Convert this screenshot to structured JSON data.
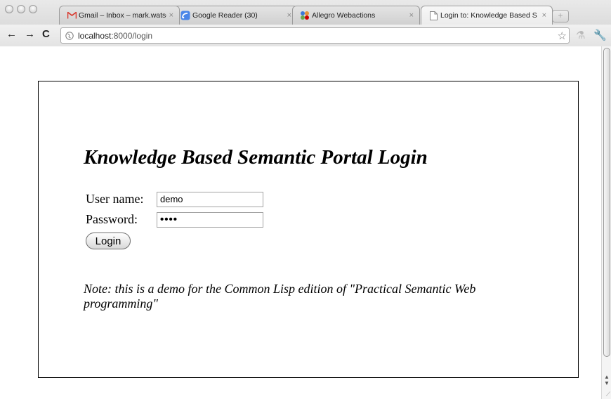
{
  "browser": {
    "tabs": [
      {
        "title": "Gmail – Inbox – mark.watsor",
        "icon": "gmail-icon",
        "active": false
      },
      {
        "title": "Google Reader (30)",
        "icon": "google-reader-icon",
        "active": false
      },
      {
        "title": "Allegro Webactions",
        "icon": "allegro-icon",
        "active": false
      },
      {
        "title": "Login to: Knowledge Based S",
        "icon": "page-icon",
        "active": true
      }
    ],
    "close_glyph": "×",
    "address": {
      "host": "localhost",
      "rest": ":8000/login"
    }
  },
  "page": {
    "title": "Knowledge Based Semantic Portal Login",
    "form": {
      "username_label": "User name:",
      "username_value": "demo",
      "password_label": "Password:",
      "password_value": "••••",
      "login_label": "Login"
    },
    "note": "Note: this is a demo for the Common Lisp edition of \"Practical Semantic Web programming\""
  },
  "colors": {
    "gmail_red": "#d93025",
    "reader_blue": "#4a86e8"
  }
}
